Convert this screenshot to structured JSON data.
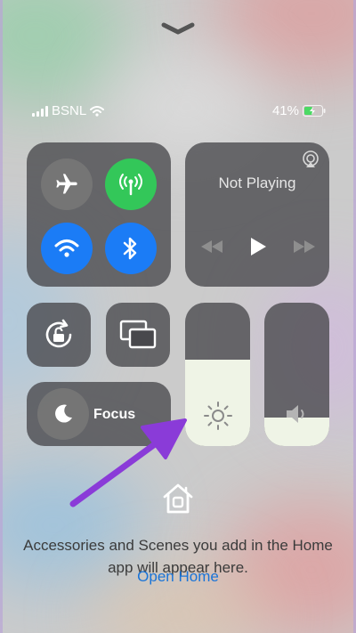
{
  "status_bar": {
    "carrier": "BSNL",
    "battery_percent": "41%",
    "signal_bars": 4,
    "charging": true
  },
  "connectivity": {
    "airplane": {
      "icon": "airplane-icon",
      "on": false
    },
    "cellular": {
      "icon": "cellular-antenna-icon",
      "on": true,
      "color": "#33c759"
    },
    "wifi": {
      "icon": "wifi-icon",
      "on": true,
      "color": "#1b7cf6"
    },
    "bluetooth": {
      "icon": "bluetooth-icon",
      "on": true,
      "color": "#1b7cf6"
    }
  },
  "now_playing": {
    "title": "Not Playing",
    "airplay_icon": "airplay-icon",
    "controls": [
      "rewind-icon",
      "play-icon",
      "fast-forward-icon"
    ]
  },
  "tiles": {
    "rotation_lock": {
      "icon": "rotation-lock-icon"
    },
    "screen_mirroring": {
      "icon": "screen-mirroring-icon"
    },
    "focus": {
      "label": "Focus",
      "icon": "moon-icon"
    }
  },
  "brightness": {
    "level": 0.6,
    "icon": "sun-icon"
  },
  "volume": {
    "level": 0.2,
    "icon": "speaker-icon"
  },
  "home": {
    "icon": "home-icon",
    "message": "Accessories and Scenes you add in the Home app will appear here.",
    "open_label": "Open Home"
  },
  "annotation": {
    "color": "#8a3bd8"
  }
}
